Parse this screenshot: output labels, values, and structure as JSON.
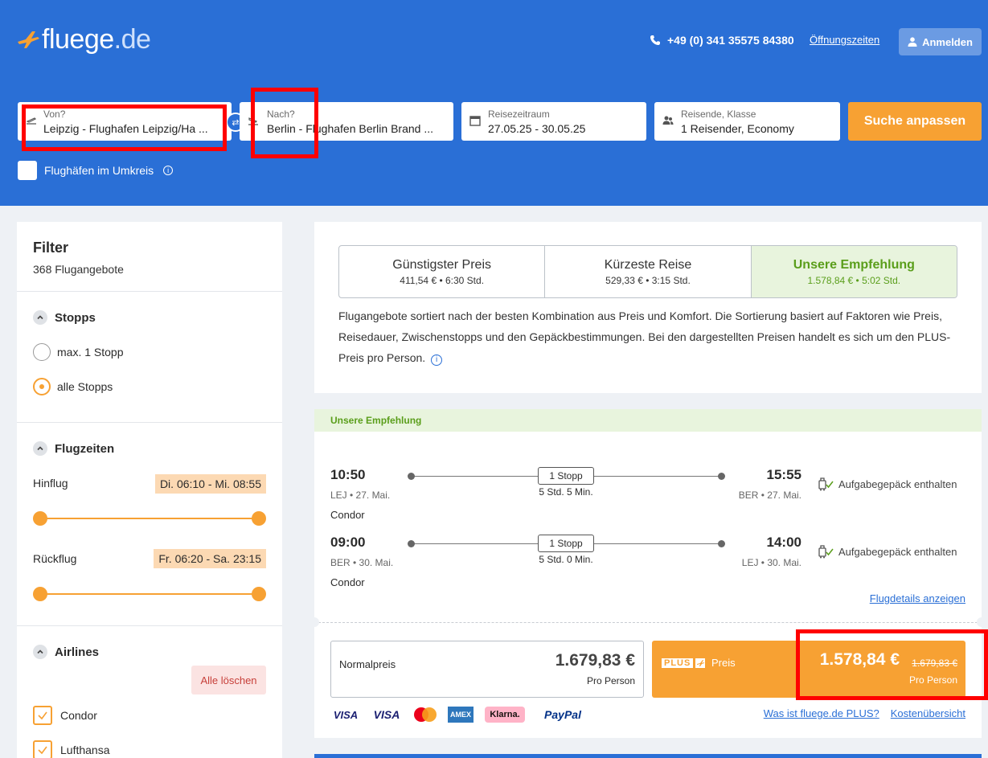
{
  "header": {
    "logo_main": "fluege",
    "logo_tld": ".de",
    "phone": "+49 (0) 341 35575 84380",
    "hours_link": "Öffnungszeiten",
    "login_label": "Anmelden"
  },
  "search": {
    "from_label": "Von?",
    "from_value": "Leipzig - Flughafen Leipzig/Ha ...",
    "to_label": "Nach?",
    "to_value": "Berlin - Flughafen Berlin Brand ...",
    "date_label": "Reisezeitraum",
    "date_value": "27.05.25 - 30.05.25",
    "pax_label": "Reisende, Klasse",
    "pax_value": "1 Reisender, Economy",
    "submit_label": "Suche anpassen",
    "nearby_label": "Flughäfen im Umkreis"
  },
  "filter": {
    "title": "Filter",
    "count": "368 Flugangebote",
    "stops": {
      "title": "Stopps",
      "options": [
        "max. 1 Stopp",
        "alle Stopps"
      ],
      "selected": "alle Stopps"
    },
    "times": {
      "title": "Flugzeiten",
      "outbound_label": "Hinflug",
      "outbound_range": "Di. 06:10 - Mi. 08:55",
      "return_label": "Rückflug",
      "return_range": "Fr. 06:20 - Sa. 23:15"
    },
    "airlines": {
      "title": "Airlines",
      "clear_label": "Alle löschen",
      "items": [
        "Condor",
        "Lufthansa"
      ]
    }
  },
  "sort": {
    "tabs": [
      {
        "title": "Günstigster Preis",
        "sub": "411,54 € • 6:30 Std."
      },
      {
        "title": "Kürzeste Reise",
        "sub": "529,33 € • 3:15 Std."
      },
      {
        "title": "Unsere Empfehlung",
        "sub": "1.578,84 € • 5:02 Std."
      }
    ],
    "active": "Unsere Empfehlung",
    "description": "Flugangebote sortiert nach der besten Kombination aus Preis und Komfort. Die Sortierung basiert auf Faktoren wie Preis, Reisedauer, Zwischenstopps und den Gepäckbestimmungen. Bei den dargestellten Preisen handelt es sich um den PLUS-Preis pro Person."
  },
  "result": {
    "banner": "Unsere Empfehlung",
    "legs": [
      {
        "dep_time": "10:50",
        "dep_info": "LEJ • 27. Mai.",
        "arr_time": "15:55",
        "arr_info": "BER • 27. Mai.",
        "stops": "1 Stopp",
        "duration": "5 Std. 5 Min.",
        "airline": "Condor",
        "baggage": "Aufgabegepäck enthalten"
      },
      {
        "dep_time": "09:00",
        "dep_info": "BER • 30. Mai.",
        "arr_time": "14:00",
        "arr_info": "LEJ • 30. Mai.",
        "stops": "1 Stopp",
        "duration": "5 Std. 0 Min.",
        "airline": "Condor",
        "baggage": "Aufgabegepäck enthalten"
      }
    ],
    "details_link": "Flugdetails anzeigen",
    "normal_label": "Normalpreis",
    "normal_price": "1.679,83 €",
    "per_person": "Pro Person",
    "plus_logo": "PLUS",
    "plus_word": "Preis",
    "plus_price": "1.578,84 €",
    "plus_old_price": "1.679,83 €",
    "payments": [
      "VISA",
      "VISA",
      "Mastercard",
      "AMEX",
      "Klarna.",
      "PayPal"
    ],
    "link_plus": "Was ist fluege.de PLUS?",
    "link_costs": "Kostenübersicht"
  },
  "colors": {
    "brand_blue": "#2a6fd6",
    "accent_orange": "#f7a133",
    "recommend_green": "#5a9e1b",
    "annotation_red": "#ff0000"
  }
}
